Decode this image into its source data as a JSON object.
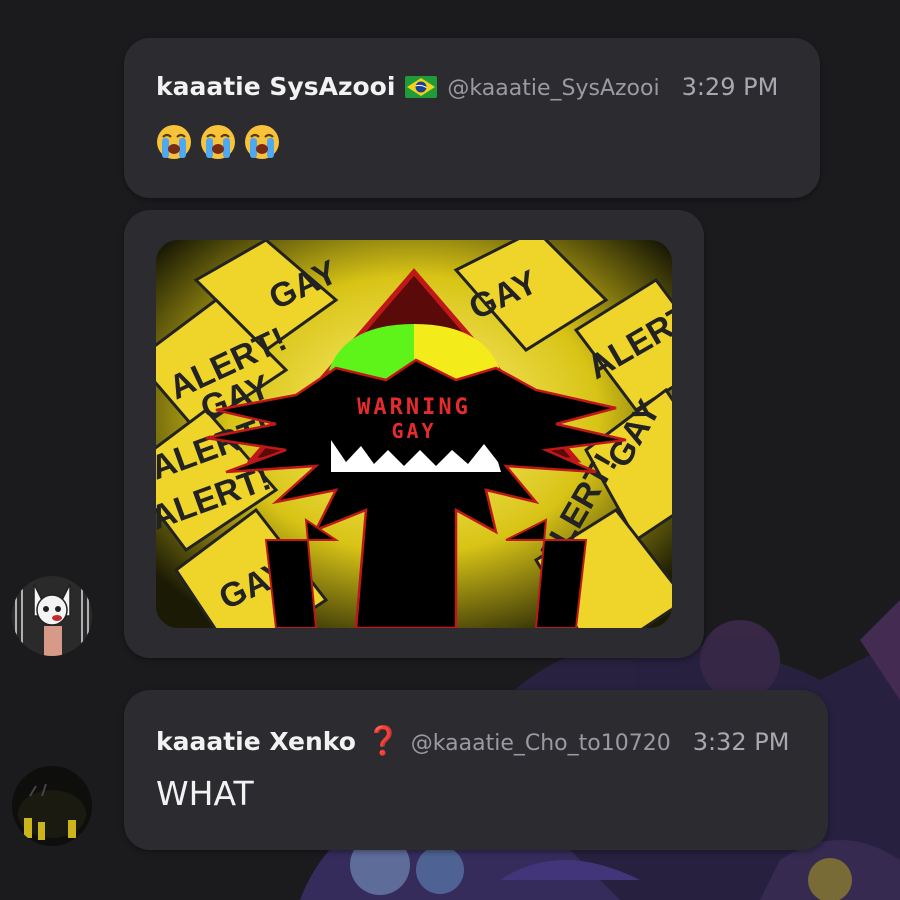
{
  "messages": [
    {
      "author": "kaaatie SysAzooi",
      "flag": "brazil-flag",
      "handle": "@kaaatie_SysAzooi",
      "time": "3:29 PM",
      "emojis": [
        "loudly-crying-face",
        "loudly-crying-face",
        "loudly-crying-face"
      ]
    },
    {
      "attachment": {
        "type": "image",
        "text_line1": "WARNING",
        "text_line2": "GAY",
        "sign_text": [
          "GAY",
          "ALERT!",
          "GAY",
          "ALERT!",
          "GAY",
          "ALERT!",
          "GAY",
          "ALERT!",
          "GAY",
          "ALERT!"
        ]
      }
    },
    {
      "author": "kaaatie Xenko",
      "badge": "❓",
      "handle": "@kaaatie_Cho_to10720",
      "time": "3:32 PM",
      "text": "WHAT"
    }
  ],
  "colors": {
    "bubble": "#2b2b30",
    "background": "#1b1b1e",
    "name": "#f2f2f2",
    "handle": "#9a9aa2",
    "warning_red": "#e52b2b",
    "sign_yellow": "#e8d41a"
  }
}
